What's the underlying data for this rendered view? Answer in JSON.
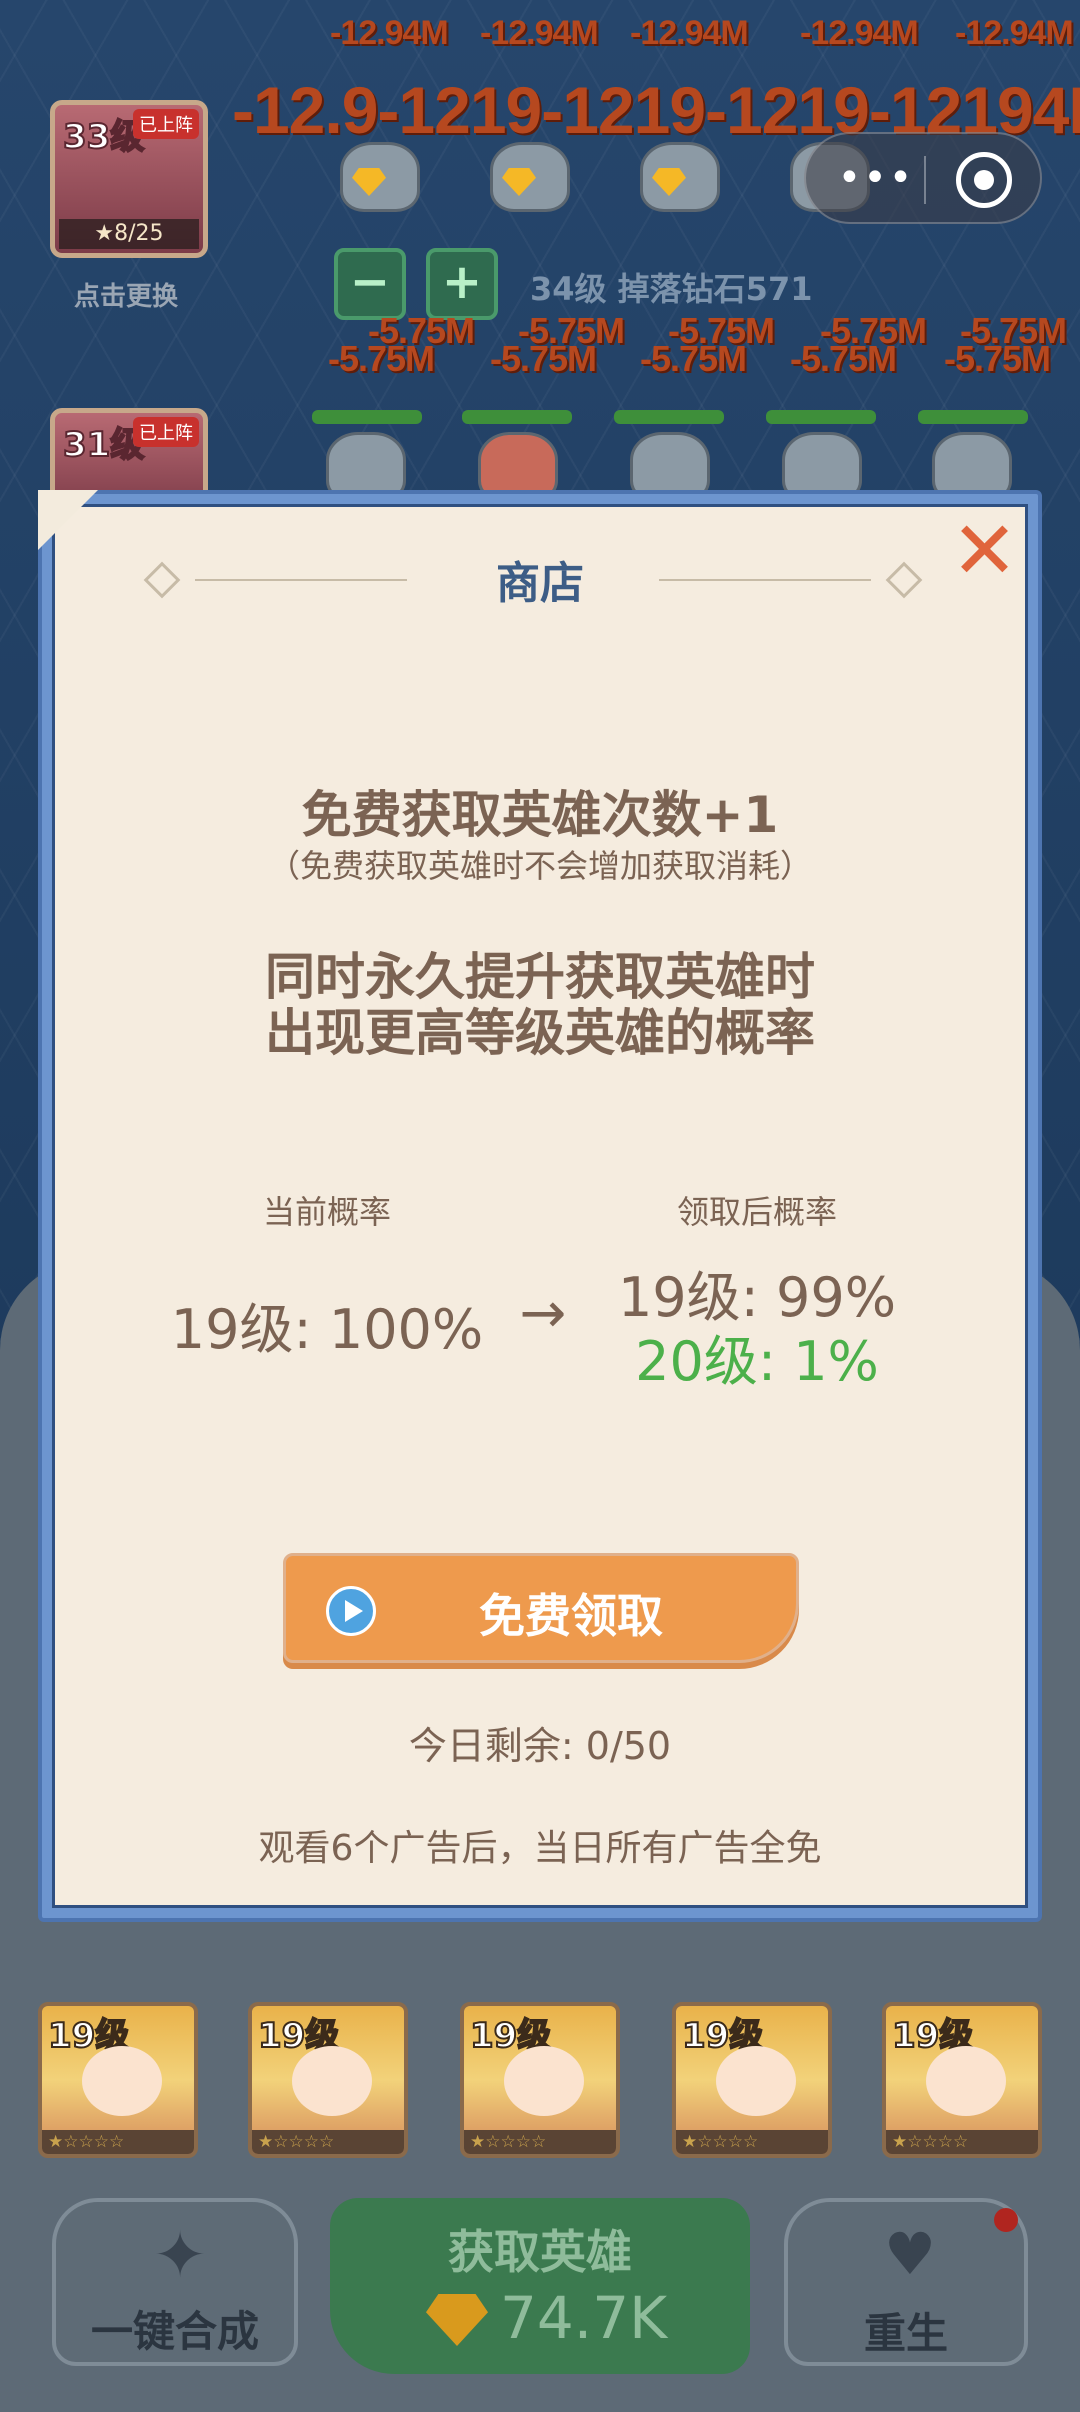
{
  "game": {
    "damage_numbers_row1": [
      "-12.94M",
      "-12.94M",
      "-12.94M",
      "-12.94M",
      "-12.94M"
    ],
    "damage_numbers_row2": "-12.9-1219-1219-1219-12194M",
    "damage_numbers_row3": [
      "-5.75M",
      "-5.75M",
      "-5.75M",
      "-5.75M",
      "-5.75M"
    ],
    "damage_numbers_row4": [
      "-5.75M",
      "-5.75M",
      "-5.75M",
      "-5.75M",
      "-5.75M"
    ],
    "top_hero": {
      "level": "33级",
      "tag": "已上阵",
      "stars": "★8/25",
      "swap": "点击更换"
    },
    "second_hero": {
      "level": "31级",
      "tag": "已上阵"
    },
    "controls": {
      "minus": "−",
      "plus": "+",
      "drop_info": "34级 掉落钻石571"
    },
    "capsule": {
      "menu_icon": "•••"
    },
    "grid": {
      "cards": [
        {
          "level": "19级",
          "stars": "★☆☆☆☆"
        },
        {
          "level": "19级",
          "stars": "★☆☆☆☆"
        },
        {
          "level": "19级",
          "stars": "★☆☆☆☆"
        },
        {
          "level": "19级",
          "stars": "★☆☆☆☆"
        },
        {
          "level": "19级",
          "stars": "★☆☆☆☆"
        }
      ],
      "partial_stars": "★☆☆☆☆"
    },
    "bottom_bar": {
      "merge_label": "一键合成",
      "get_hero_label": "获取英雄",
      "get_hero_cost": "74.7K",
      "rebirth_label": "重生"
    }
  },
  "modal": {
    "title": "商店",
    "close_icon": "close-icon",
    "headline": "免费获取英雄次数+1",
    "subline": "（免费获取英雄时不会增加获取消耗）",
    "desc_line1": "同时永久提升获取英雄时",
    "desc_line2": "出现更高等级英雄的概率",
    "current_label": "当前概率",
    "current_value": "19级: 100%",
    "arrow": "→",
    "after_label": "领取后概率",
    "after_value_1": "19级: 99%",
    "after_value_2": "20级: 1%",
    "claim_button": "免费领取",
    "remaining": "今日剩余: 0/50",
    "ad_note": "观看6个广告后，当日所有广告全免"
  },
  "colors": {
    "modal_bg": "#f5ecdf",
    "frame_blue": "#6d95cf",
    "title_blue": "#3d5d86",
    "text_brown": "#7b6353",
    "accent_orange": "#ee9a4d",
    "prob_green": "#4cb04a",
    "close_red": "#e0643b"
  }
}
